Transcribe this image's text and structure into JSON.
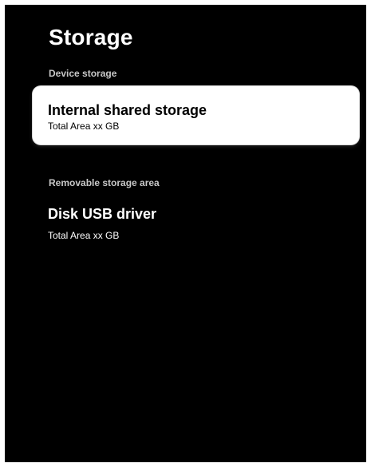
{
  "page": {
    "title": "Storage"
  },
  "sections": {
    "device": {
      "header": "Device storage",
      "item": {
        "title": "Internal shared storage",
        "subtitle": "Total Area xx GB",
        "focused": true
      }
    },
    "removable": {
      "header": "Removable storage area",
      "item": {
        "title": "Disk USB driver",
        "subtitle": "Total Area xx GB",
        "focused": false
      }
    }
  },
  "colors": {
    "background": "#000000",
    "focus_card": "#ffffff",
    "section_header": "#c8c8c8",
    "text_primary": "#ffffff"
  }
}
